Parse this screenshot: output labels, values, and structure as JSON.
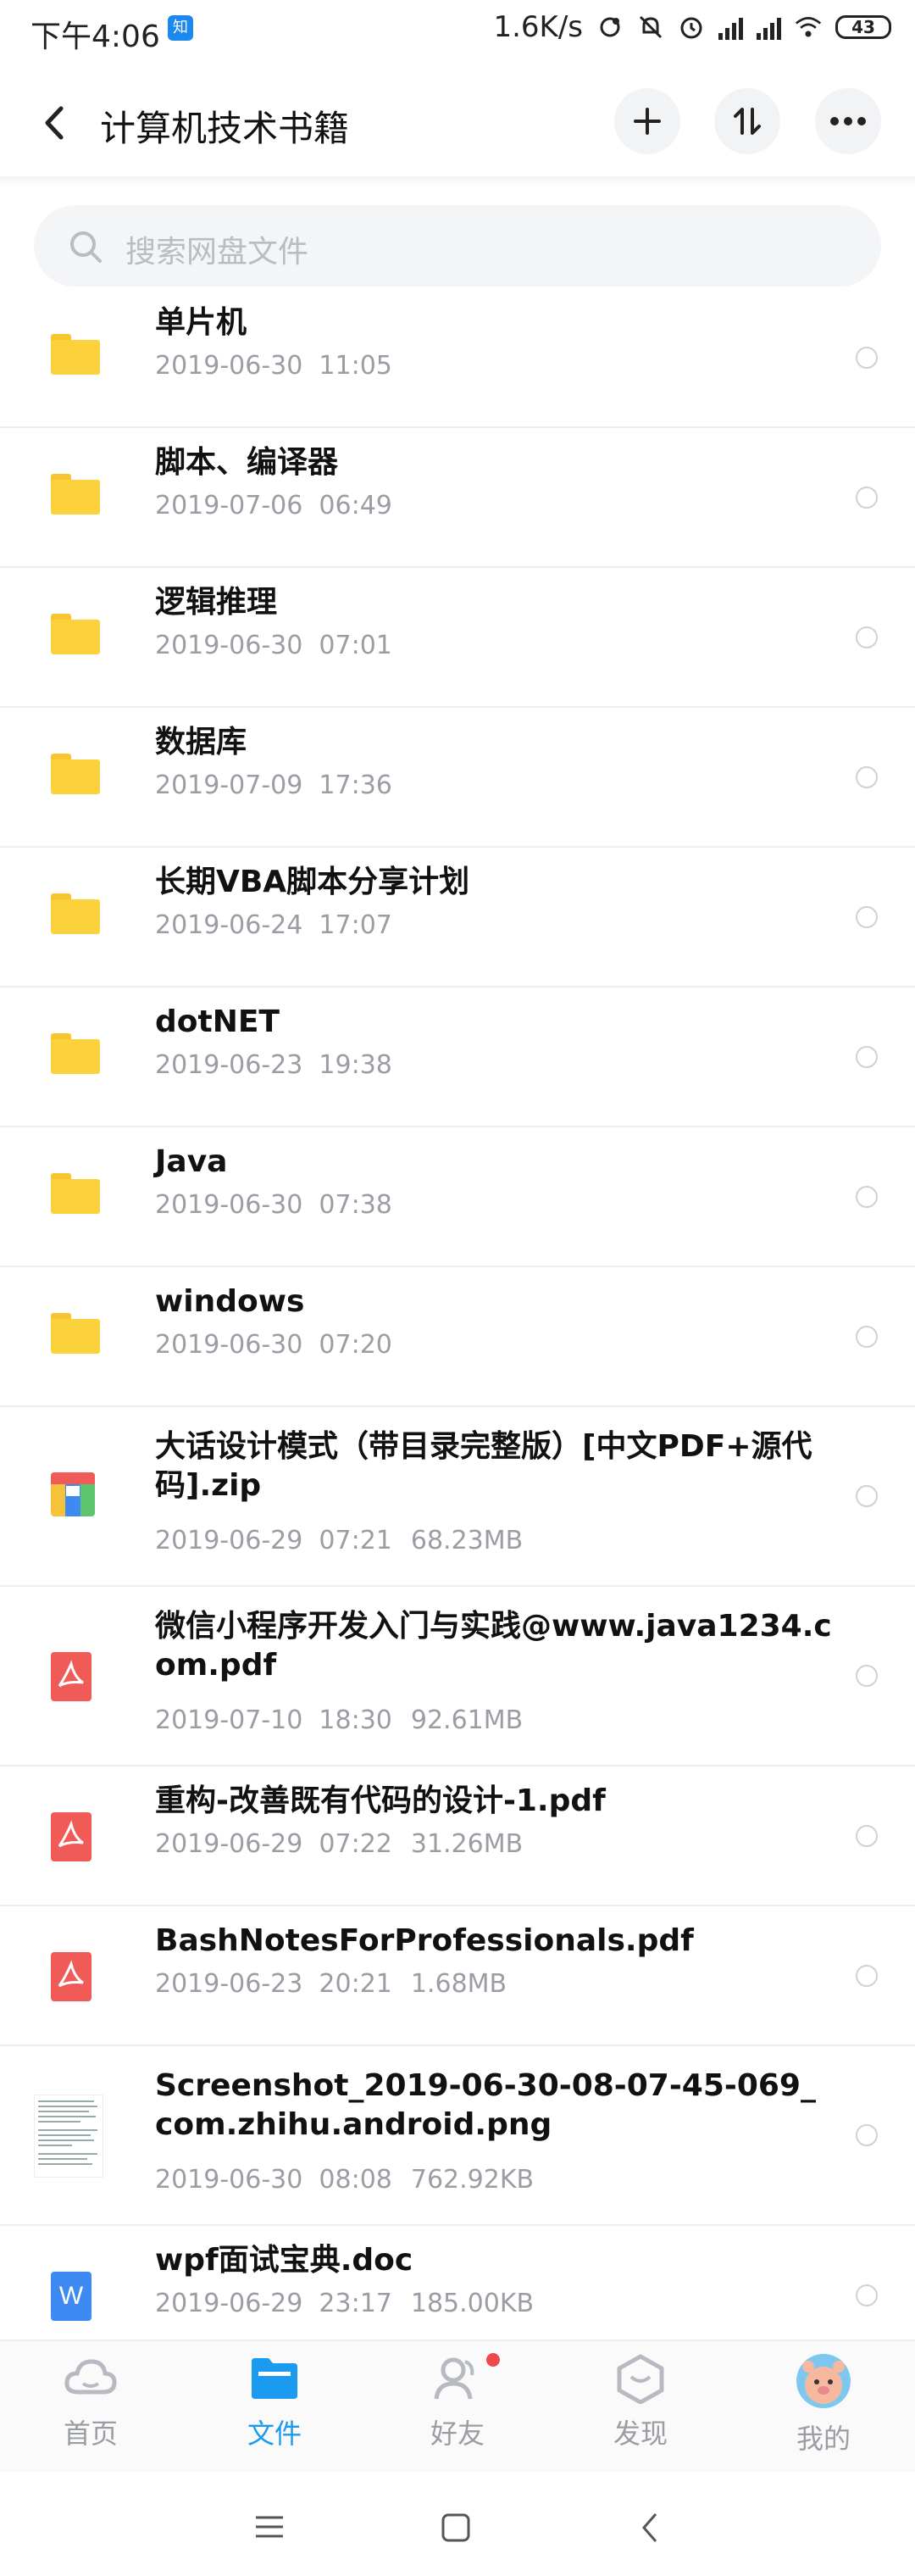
{
  "status": {
    "time": "下午4:06",
    "app_badge": "知",
    "speed": "1.6K/s",
    "battery": "43"
  },
  "header": {
    "title": "计算机技术书籍"
  },
  "search": {
    "placeholder": "搜索网盘文件"
  },
  "files": [
    {
      "type": "folder",
      "name": "单片机",
      "date": "2019-06-30  11:05",
      "size": ""
    },
    {
      "type": "folder",
      "name": "脚本、编译器",
      "date": "2019-07-06  06:49",
      "size": ""
    },
    {
      "type": "folder",
      "name": "逻辑推理",
      "date": "2019-06-30  07:01",
      "size": ""
    },
    {
      "type": "folder",
      "name": "数据库",
      "date": "2019-07-09  17:36",
      "size": ""
    },
    {
      "type": "folder",
      "name": "长期VBA脚本分享计划",
      "date": "2019-06-24  17:07",
      "size": ""
    },
    {
      "type": "folder",
      "name": "dotNET",
      "date": "2019-06-23  19:38",
      "size": ""
    },
    {
      "type": "folder",
      "name": "Java",
      "date": "2019-06-30  07:38",
      "size": ""
    },
    {
      "type": "folder",
      "name": "windows",
      "date": "2019-06-30  07:20",
      "size": ""
    },
    {
      "type": "zip",
      "name": "大话设计模式（带目录完整版）[中文PDF+源代码].zip",
      "date": "2019-06-29  07:21",
      "size": "68.23MB"
    },
    {
      "type": "pdf",
      "name": "微信小程序开发入门与实践@www.java1234.com.pdf",
      "date": "2019-07-10  18:30",
      "size": "92.61MB"
    },
    {
      "type": "pdf",
      "name": "重构-改善既有代码的设计-1.pdf",
      "date": "2019-06-29  07:22",
      "size": "31.26MB"
    },
    {
      "type": "pdf",
      "name": "BashNotesForProfessionals.pdf",
      "date": "2019-06-23  20:21",
      "size": "1.68MB"
    },
    {
      "type": "image",
      "name": "Screenshot_2019-06-30-08-07-45-069_com.zhihu.android.png",
      "date": "2019-06-30  08:08",
      "size": "762.92KB"
    },
    {
      "type": "doc",
      "name": "wpf面试宝典.doc",
      "date": "2019-06-29  23:17",
      "size": "185.00KB"
    }
  ],
  "tabs": [
    {
      "label": "首页",
      "icon": "cloud-icon"
    },
    {
      "label": "文件",
      "icon": "folder-icon"
    },
    {
      "label": "好友",
      "icon": "friends-icon"
    },
    {
      "label": "发现",
      "icon": "discover-icon"
    },
    {
      "label": "我的",
      "icon": "avatar-icon"
    }
  ],
  "colors": {
    "accent": "#1a9bf0",
    "folder": "#fcd23c",
    "pdf": "#f05a57",
    "doc": "#3d8bf2"
  }
}
